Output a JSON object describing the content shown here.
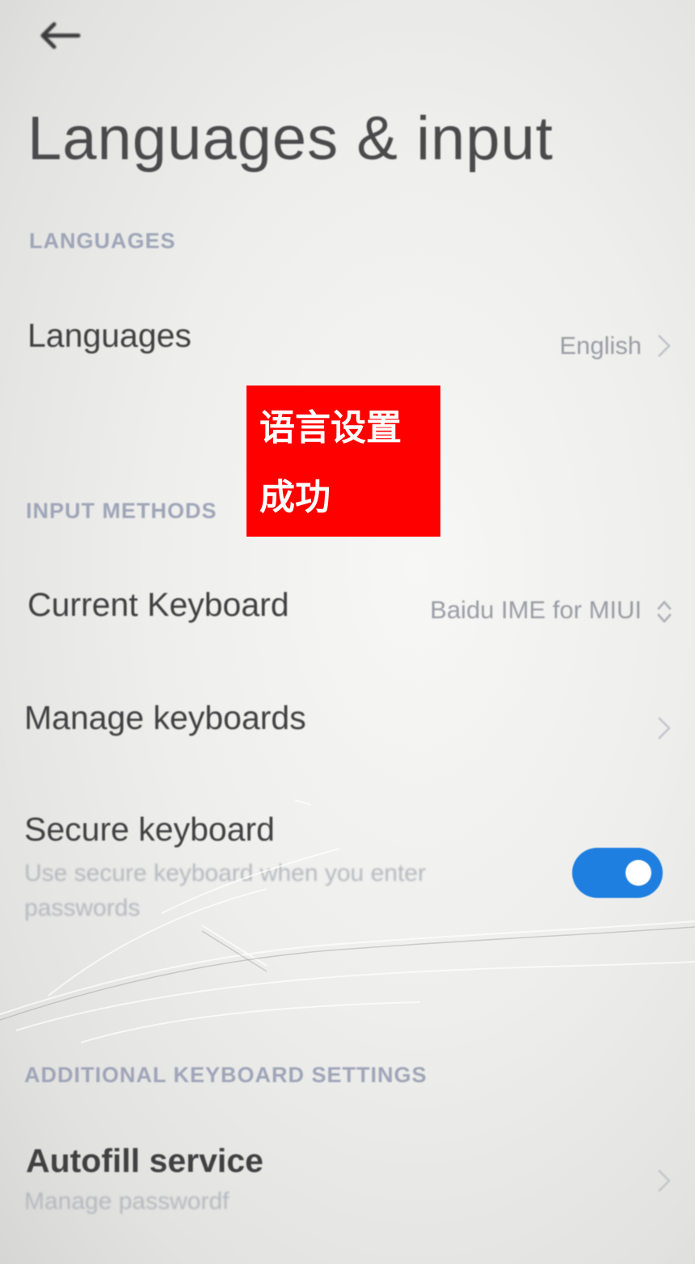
{
  "header": {
    "back_icon": "back-arrow-icon",
    "title": "Languages & input"
  },
  "sections": {
    "languages_header": "LANGUAGES",
    "input_methods_header": "INPUT METHODS",
    "additional_header": "ADDITIONAL KEYBOARD SETTINGS"
  },
  "languages_row": {
    "title": "Languages",
    "value": "English"
  },
  "current_keyboard": {
    "title": "Current Keyboard",
    "value": "Baidu IME for MIUI"
  },
  "manage_keyboards": {
    "title": "Manage keyboards"
  },
  "secure_keyboard": {
    "title": "Secure keyboard",
    "subtitle": "Use secure keyboard when you enter passwords",
    "enabled": true
  },
  "autofill": {
    "title": "Autofill service",
    "subtitle": "Manage passwordf"
  },
  "overlay": {
    "text": "语言设置成功"
  },
  "colors": {
    "toggle_on": "#1f7fe0",
    "overlay_bg": "#ff0000",
    "section_header": "#9fa5b8"
  }
}
